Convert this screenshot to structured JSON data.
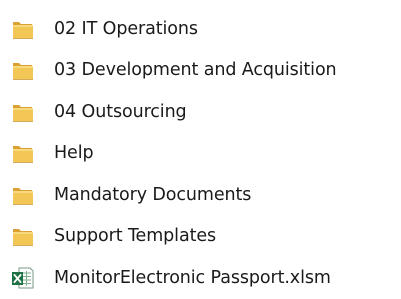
{
  "explorer": {
    "items": [
      {
        "label": "02 IT Operations",
        "icon": "folder-icon",
        "type": "folder"
      },
      {
        "label": "03 Development and Acquisition",
        "icon": "folder-icon",
        "type": "folder"
      },
      {
        "label": "04 Outsourcing",
        "icon": "folder-icon",
        "type": "folder"
      },
      {
        "label": "Help",
        "icon": "folder-icon",
        "type": "folder"
      },
      {
        "label": "Mandatory Documents",
        "icon": "folder-icon",
        "type": "folder"
      },
      {
        "label": "Support Templates",
        "icon": "folder-icon",
        "type": "folder"
      },
      {
        "label": "MonitorElectronic Passport.xlsm",
        "icon": "excel-file-icon",
        "type": "file"
      }
    ]
  },
  "colors": {
    "folder_front": "#f3c95a",
    "folder_back": "#dca534",
    "excel_green": "#1e7145",
    "text": "#1a1a1a",
    "background": "#ffffff"
  }
}
